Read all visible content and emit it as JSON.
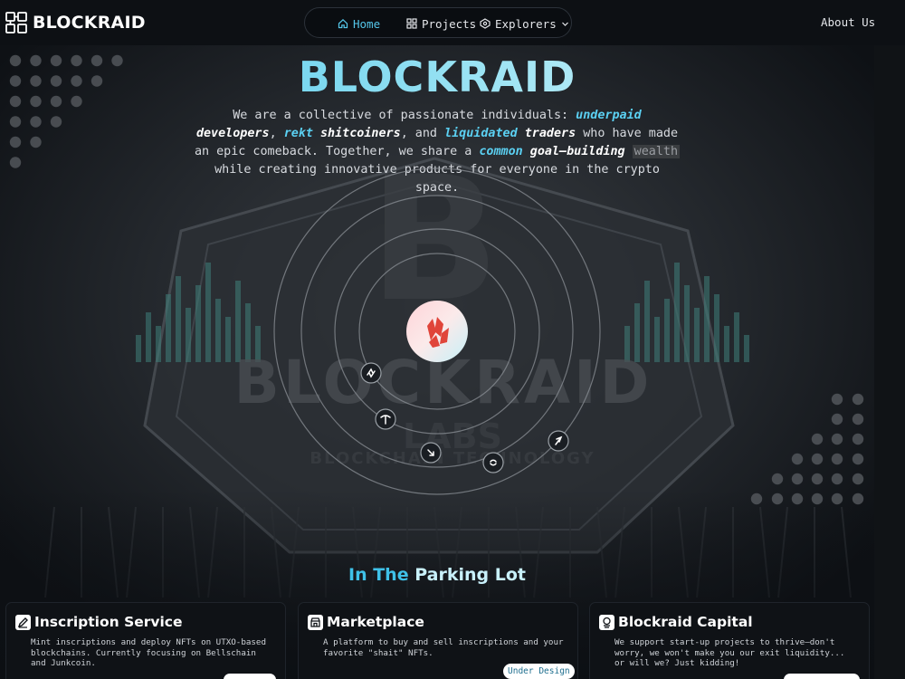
{
  "brand": {
    "name": "BLOCKRAID"
  },
  "nav": {
    "items": [
      {
        "label": "Home",
        "icon": "home-icon",
        "active": true
      },
      {
        "label": "Projects",
        "icon": "grid-icon",
        "active": false
      },
      {
        "label": "Explorers",
        "icon": "network-icon",
        "active": false,
        "dropdown": true
      }
    ],
    "about": "About Us"
  },
  "hero": {
    "title": "BLOCKRAID",
    "desc": {
      "p1": "We are a collective of passionate individuals: ",
      "e1": "underpaid",
      "e2": "developers",
      "p2": ",",
      "e3": "rekt",
      "e4": "shitcoiners",
      "p3": ", and ",
      "e5": "liquidated",
      "e6": "traders",
      "p4": " who have made an epic comeback. Together, we share a ",
      "e7": "common",
      "e8": "goal—building",
      "hl": "wealth",
      "p5": " while creating innovative products for everyone in the crypto space."
    }
  },
  "orbit": {
    "center_icon": "crystal-logo-icon",
    "satellites": [
      "sync-icon",
      "pickaxe-icon",
      "arrow-down-right-icon",
      "refresh-circle-icon",
      "rocket-icon"
    ]
  },
  "section": {
    "title_a": "In The ",
    "title_b": "Parking Lot"
  },
  "cards": [
    {
      "title": "Inscription Service",
      "icon": "pen-icon",
      "desc": "Mint inscriptions and deploy NFTs on UTXO-based blockchains. Currently focusing on Bellschain and Junkcoin."
    },
    {
      "title": "Marketplace",
      "icon": "store-icon",
      "desc": "A platform to buy and sell inscriptions and your favorite \"shait\" NFTs.",
      "badge": "Under Design"
    },
    {
      "title": "Blockraid Capital",
      "icon": "coins-icon",
      "desc": "We support start-up projects to thrive—don't worry, we won't make you our exit liquidity... or will we? Just kidding!"
    }
  ],
  "colors": {
    "accent": "#43c4ea",
    "background": "#0c0f13",
    "card": "#0f1216"
  }
}
